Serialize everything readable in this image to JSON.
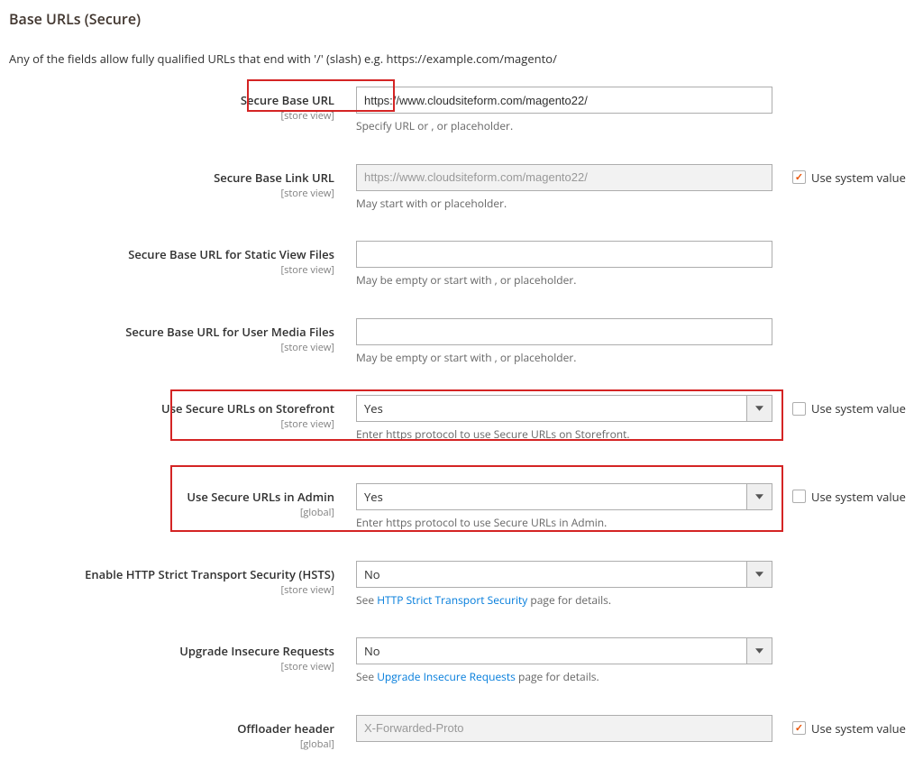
{
  "section_title": "Base URLs (Secure)",
  "section_desc": "Any of the fields allow fully qualified URLs that end with '/' (slash) e.g. https://example.com/magento/",
  "scope_storeview": "[store view]",
  "scope_global": "[global]",
  "use_system_value": "Use system value",
  "fields": {
    "base_url": {
      "label": "Secure Base URL",
      "value": "https://www.cloudsiteform.com/magento22/",
      "hint": "Specify URL or , or placeholder."
    },
    "link_url": {
      "label": "Secure Base Link URL",
      "value": "https://www.cloudsiteform.com/magento22/",
      "hint": "May start with or placeholder."
    },
    "static_url": {
      "label": "Secure Base URL for Static View Files",
      "value": "",
      "hint": "May be empty or start with , or placeholder."
    },
    "media_url": {
      "label": "Secure Base URL for User Media Files",
      "value": "",
      "hint": "May be empty or start with , or placeholder."
    },
    "storefront": {
      "label": "Use Secure URLs on Storefront",
      "value": "Yes",
      "hint": "Enter https protocol to use Secure URLs on Storefront."
    },
    "admin": {
      "label": "Use Secure URLs in Admin",
      "value": "Yes",
      "hint": "Enter https protocol to use Secure URLs in Admin."
    },
    "hsts": {
      "label": "Enable HTTP Strict Transport Security (HSTS)",
      "value": "No",
      "hint_prefix": "See ",
      "hint_link": "HTTP Strict Transport Security",
      "hint_suffix": " page for details."
    },
    "upgrade": {
      "label": "Upgrade Insecure Requests",
      "value": "No",
      "hint_prefix": "See ",
      "hint_link": "Upgrade Insecure Requests",
      "hint_suffix": " page for details."
    },
    "offloader": {
      "label": "Offloader header",
      "value": "X-Forwarded-Proto"
    }
  }
}
